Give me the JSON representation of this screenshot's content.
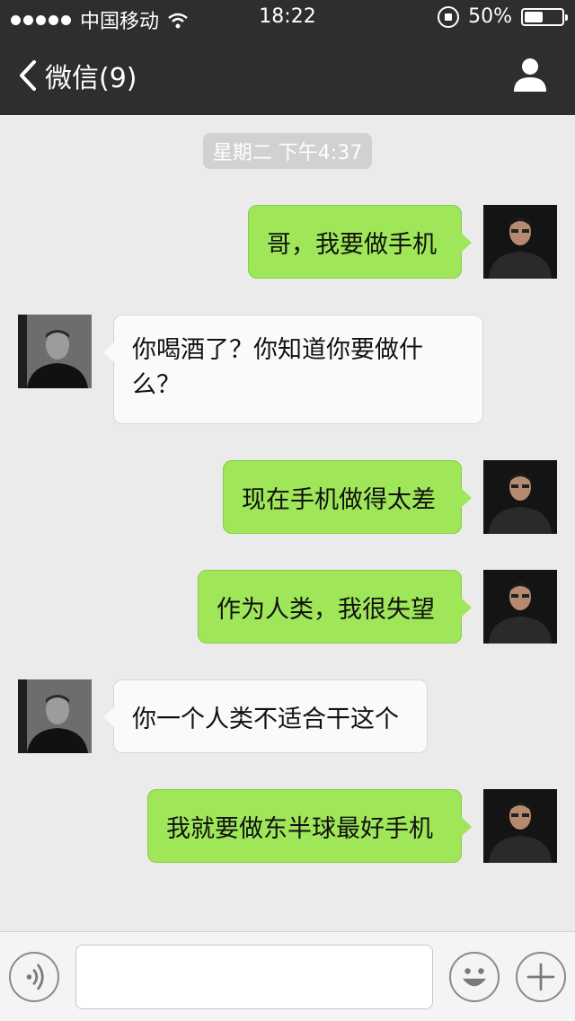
{
  "status_bar": {
    "carrier": "中国移动",
    "time": "18:22",
    "battery_percent": "50%",
    "battery_level": 0.5,
    "signal_dots": 5
  },
  "nav": {
    "back_label": "微信(9)",
    "back_icon": "chevron-left-icon",
    "profile_icon": "person-icon"
  },
  "chat": {
    "timestamp": "星期二 下午4:37",
    "messages": [
      {
        "side": "right",
        "text": "哥，我要做手机"
      },
      {
        "side": "left",
        "text": "你喝酒了？你知道你要做什么？"
      },
      {
        "side": "right",
        "text": "现在手机做得太差"
      },
      {
        "side": "right",
        "text": "作为人类，我很失望"
      },
      {
        "side": "left",
        "text": "你一个人类不适合干这个"
      },
      {
        "side": "right",
        "text": "我就要做东半球最好手机"
      }
    ]
  },
  "input_bar": {
    "voice_icon": "voice-icon",
    "text_value": "",
    "emoji_icon": "emoji-icon",
    "plus_icon": "plus-icon"
  },
  "colors": {
    "header_bg": "#2e2e31",
    "chat_bg": "#ebebeb",
    "sent_bubble": "#9fe658",
    "received_bubble": "#fafafa"
  }
}
